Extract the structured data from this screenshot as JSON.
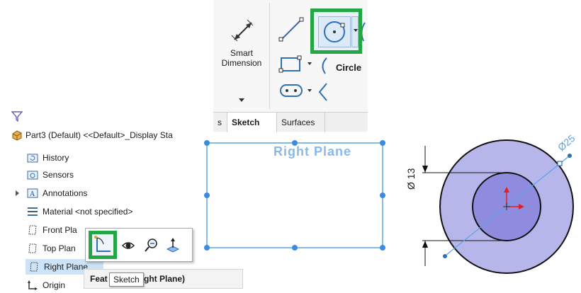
{
  "ribbon": {
    "smart_dimension_label": "Smart Dimension",
    "circle_label": "Circle",
    "tabs": [
      {
        "label": "s",
        "active": false
      },
      {
        "label": "Sketch",
        "active": true
      },
      {
        "label": "Surfaces",
        "active": false
      }
    ]
  },
  "tree": {
    "filter_icon": "filter-icon",
    "root_label": "Part3 (Default) <<Default>_Display Sta",
    "items": [
      {
        "label": "History",
        "icon": "history-folder-icon"
      },
      {
        "label": "Sensors",
        "icon": "sensors-folder-icon"
      },
      {
        "label": "Annotations",
        "icon": "annotations-icon",
        "expandable": true
      },
      {
        "label": "Material <not specified>",
        "icon": "material-icon"
      },
      {
        "label": "Front Pla",
        "icon": "plane-icon"
      },
      {
        "label": "Top Plan",
        "icon": "plane-icon"
      },
      {
        "label": "Right Plane",
        "icon": "plane-icon",
        "selected": true
      },
      {
        "label": "Origin",
        "icon": "origin-icon"
      }
    ]
  },
  "context_toolbar": {
    "tooltip": "Sketch",
    "feature_bar_prefix": "Feat",
    "feature_bar_suffix": "ght Plane)"
  },
  "graphics": {
    "plane_label": "Right Plane",
    "dimension_13": "Ø 13",
    "dimension_25": "Ø25"
  },
  "colors": {
    "highlight_green": "#23a745",
    "selection_blue": "#5aa3e6",
    "outer_disk": "#b7b6ea",
    "inner_disk": "#8f8ce0"
  }
}
